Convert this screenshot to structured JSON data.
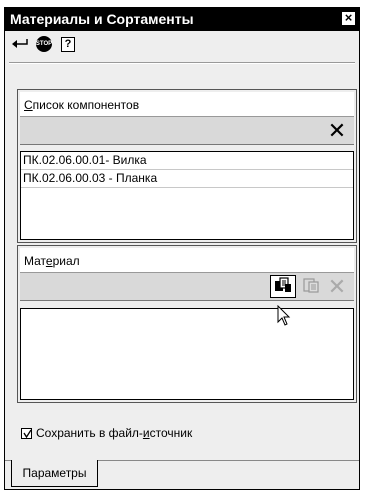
{
  "window": {
    "title": "Материалы и Сортаменты",
    "close_glyph": "×"
  },
  "toolbar": {
    "items": [
      {
        "icon": "enter-icon"
      },
      {
        "icon": "stop-icon",
        "label": "STOP"
      },
      {
        "icon": "help-icon",
        "label": "?"
      }
    ]
  },
  "components": {
    "title": "Список компонентов",
    "title_hotkey_char": "С",
    "title_rest": "писок компонентов",
    "items": [
      "ПК.02.06.00.01- Вилка",
      "ПК.02.06.00.03 - Планка"
    ]
  },
  "material": {
    "title_pre": "Мат",
    "title_hotkey_char": "е",
    "title_post": "риал"
  },
  "save_option": {
    "label_pre": "Сохранить в файл-",
    "label_hotkey_char": "и",
    "label_post": "сточник",
    "checked": true
  },
  "tabs": [
    {
      "label": "Параметры",
      "active": true
    }
  ]
}
